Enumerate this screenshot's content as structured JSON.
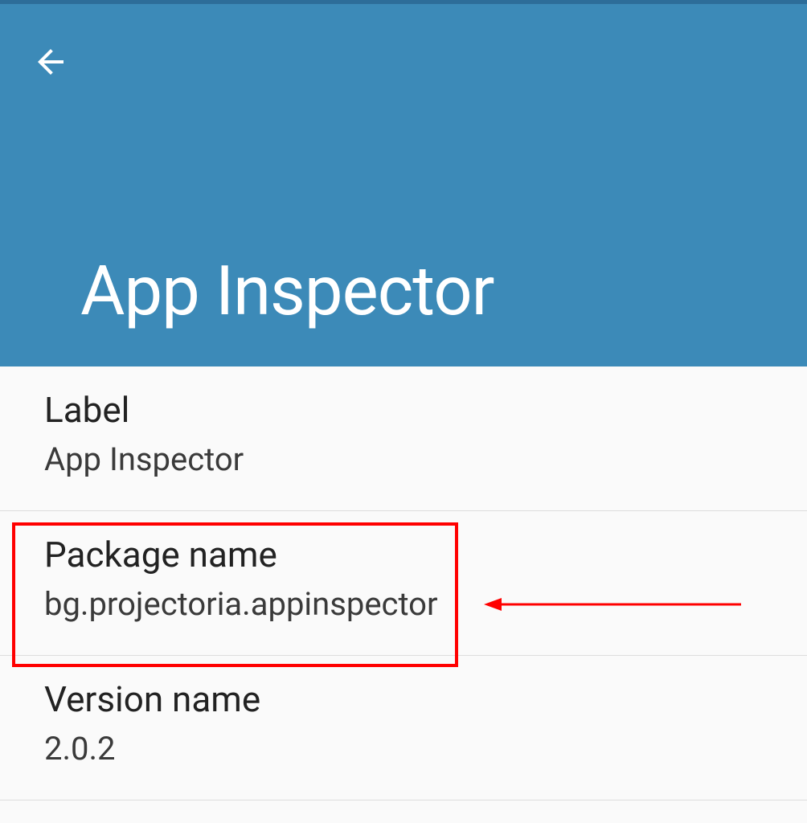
{
  "header": {
    "title": "App Inspector"
  },
  "items": [
    {
      "title": "Label",
      "value": "App Inspector"
    },
    {
      "title": "Package name",
      "value": "bg.projectoria.appinspector"
    },
    {
      "title": "Version name",
      "value": "2.0.2"
    }
  ],
  "annotation": {
    "highlighted_item_index": 1
  }
}
